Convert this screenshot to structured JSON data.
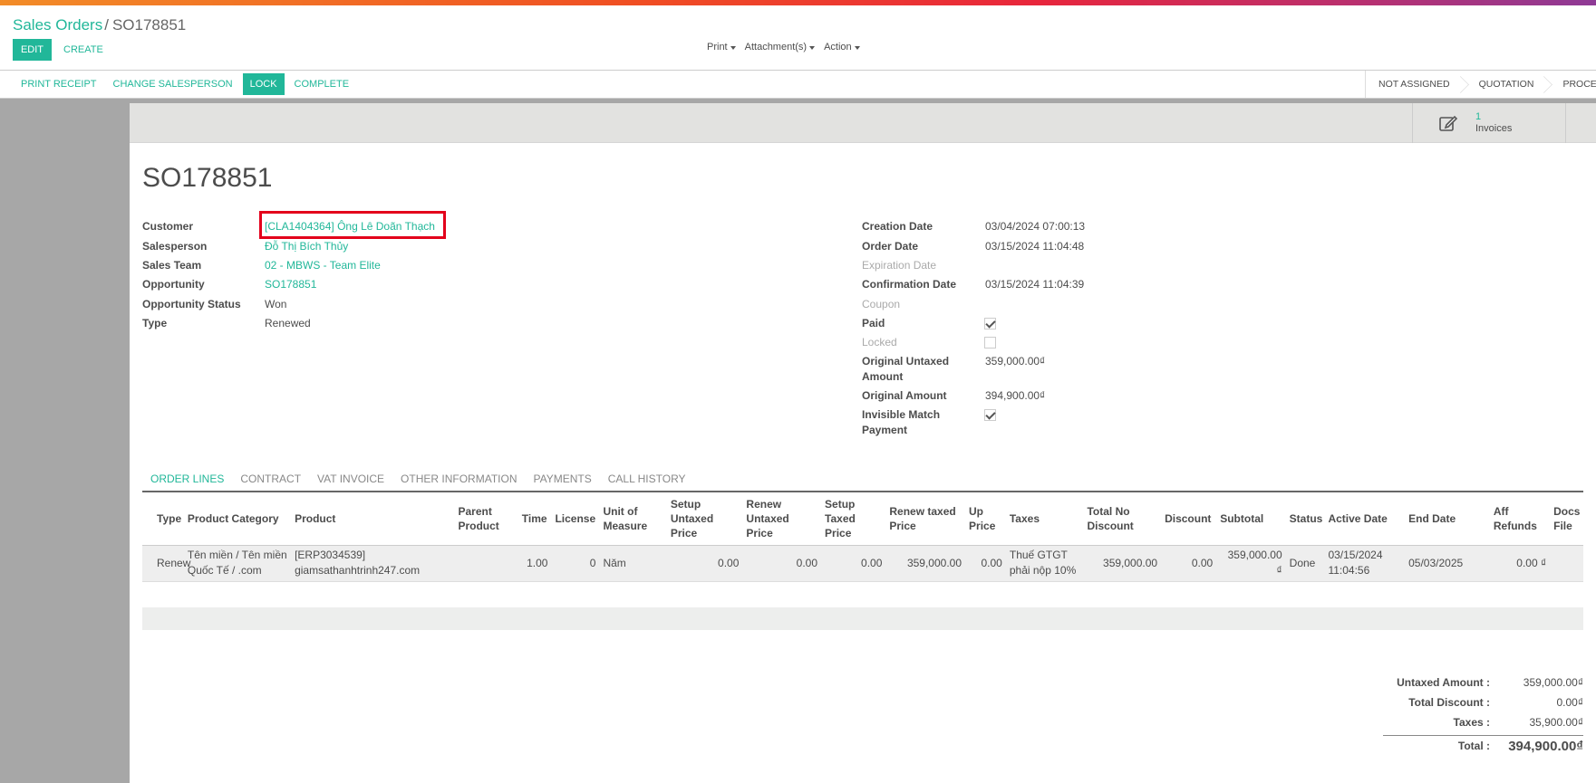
{
  "breadcrumb": {
    "parent": "Sales Orders",
    "separator": "/",
    "current": "SO178851"
  },
  "toolbar": {
    "edit_label": "EDIT",
    "create_label": "CREATE",
    "print_label": "Print",
    "attachments_label": "Attachment(s)",
    "action_label": "Action"
  },
  "statusbar": {
    "actions": [
      "PRINT RECEIPT",
      "CHANGE SALESPERSON",
      "LOCK",
      "COMPLETE"
    ],
    "stages": [
      "NOT ASSIGNED",
      "QUOTATION",
      "PROCESS"
    ]
  },
  "stat_button": {
    "value": "1",
    "label": "Invoices",
    "icon": "edit-icon"
  },
  "record_title": "SO178851",
  "left_fields": {
    "customer": {
      "label": "Customer",
      "value": "[CLA1404364] Ông Lê Doãn Thạch"
    },
    "salesperson": {
      "label": "Salesperson",
      "value": "Đỗ Thị Bích Thủy"
    },
    "sales_team": {
      "label": "Sales Team",
      "value": "02 - MBWS - Team Elite"
    },
    "opportunity": {
      "label": "Opportunity",
      "value": "SO178851"
    },
    "opportunity_status": {
      "label": "Opportunity Status",
      "value": "Won"
    },
    "type": {
      "label": "Type",
      "value": "Renewed"
    }
  },
  "right_fields": {
    "creation_date": {
      "label": "Creation Date",
      "value": "03/04/2024 07:00:13"
    },
    "order_date": {
      "label": "Order Date",
      "value": "03/15/2024 11:04:48"
    },
    "expiration_date": {
      "label": "Expiration Date",
      "value": ""
    },
    "confirmation_date": {
      "label": "Confirmation Date",
      "value": "03/15/2024 11:04:39"
    },
    "coupon": {
      "label": "Coupon",
      "value": ""
    },
    "paid": {
      "label": "Paid",
      "checked": true
    },
    "locked": {
      "label": "Locked",
      "checked": false
    },
    "original_untaxed_line1": "Original Untaxed",
    "original_untaxed_line2": "Amount",
    "original_untaxed_value": "359,000.00₫",
    "original_amount": {
      "label": "Original Amount",
      "value": "394,900.00₫"
    },
    "invisible_match_line1": "Invisible Match",
    "invisible_match_line2": "Payment",
    "invisible_match_checked": true
  },
  "tabs": [
    "ORDER LINES",
    "CONTRACT",
    "VAT INVOICE",
    "OTHER INFORMATION",
    "PAYMENTS",
    "CALL HISTORY"
  ],
  "order_lines": {
    "headers": [
      "Type",
      "Product Category",
      "Product",
      "Parent Product",
      "Time",
      "License",
      "Unit of Measure",
      "Setup Untaxed Price",
      "Renew Untaxed Price",
      "Setup Taxed Price",
      "Renew taxed Price",
      "Up Price",
      "Taxes",
      "Total No Discount",
      "Discount",
      "Subtotal",
      "Status",
      "Active Date",
      "End Date",
      "Aff Refunds",
      "Docs File"
    ],
    "rows": [
      {
        "type": "Renew",
        "product_category": "Tên miền / Tên miền Quốc Tế / .com",
        "product": "[ERP3034539] giamsathanhtrinh247.com",
        "parent_product": "",
        "time": "1.00",
        "license": "0",
        "uom": "Năm",
        "setup_untaxed": "0.00",
        "renew_untaxed": "0.00",
        "setup_taxed": "0.00",
        "renew_taxed": "359,000.00",
        "up_price": "0.00",
        "taxes": "Thuế GTGT phải nộp 10%",
        "total_no_discount": "359,000.00",
        "discount": "0.00",
        "subtotal": "359,000.00 ₫",
        "status": "Done",
        "active_date": "03/15/2024 11:04:56",
        "end_date": "05/03/2025",
        "aff_refunds": "0.00 ₫",
        "docs_file": ""
      }
    ]
  },
  "totals": {
    "untaxed_label": "Untaxed Amount :",
    "untaxed_value": "359,000.00₫",
    "discount_label": "Total Discount :",
    "discount_value": "0.00₫",
    "taxes_label": "Taxes :",
    "taxes_value": "35,900.00₫",
    "total_label": "Total :",
    "total_value": "394,900.00₫"
  },
  "colors": {
    "accent": "#21b799",
    "highlight": "#e3001b",
    "sheet_bg": "#a7a7a7"
  }
}
